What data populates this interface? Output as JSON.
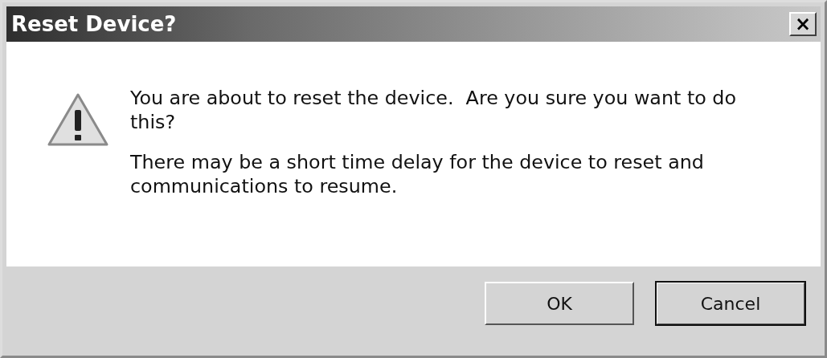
{
  "window": {
    "title": "Reset Device?",
    "close": "×"
  },
  "message": {
    "paragraphs": [
      "You are about to reset the device.  Are you sure you want to do this?",
      "There may be a short time delay for the device to reset and communications to resume."
    ]
  },
  "buttons": [
    {
      "label": "OK",
      "default": false
    },
    {
      "label": "Cancel",
      "default": true
    }
  ]
}
